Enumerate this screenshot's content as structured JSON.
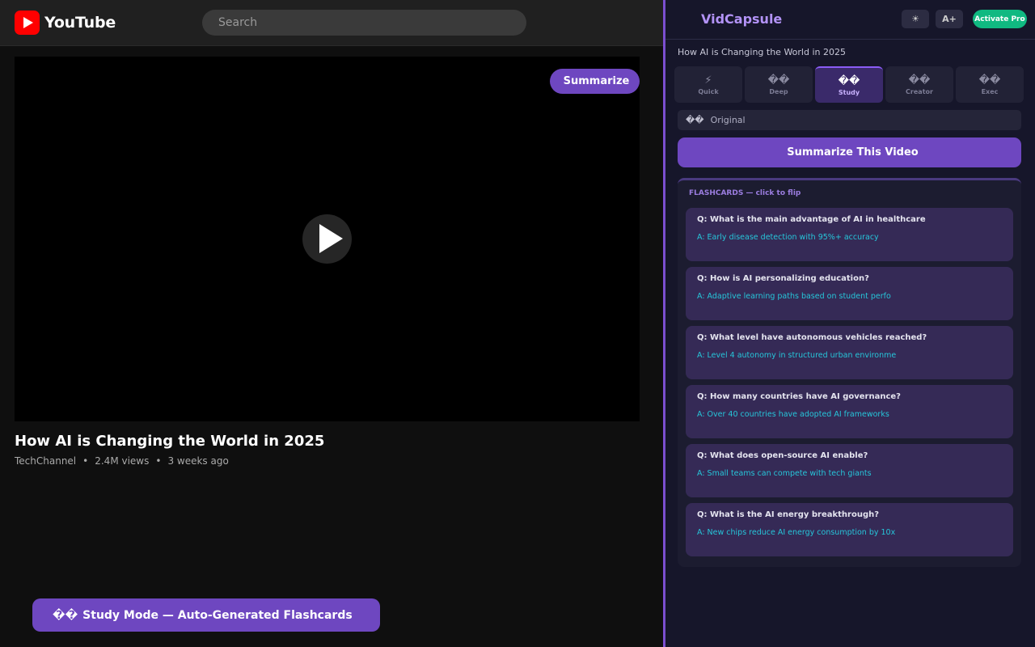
{
  "youtube": {
    "logo_text": "YouTube",
    "search_placeholder": "Search",
    "overlay_button": {
      "icon": "",
      "label": "Summarize"
    },
    "video": {
      "title": "How AI is Changing the World in 2025",
      "channel": "TechChannel",
      "separator": "•",
      "views": "2.4M views",
      "age": "3 weeks ago"
    },
    "study_banner": {
      "icon": "��",
      "label": "Study Mode — Auto-Generated Flashcards"
    }
  },
  "vidcapsule": {
    "logo_icon": "",
    "title": "VidCapsule",
    "theme_button": "☀",
    "font_button": "A+",
    "pro_button": "Activate Pro",
    "video_title": "How AI is Changing the World in 2025",
    "modes": [
      {
        "icon": "⚡",
        "label": "Quick",
        "active": false
      },
      {
        "icon": "��",
        "label": "Deep",
        "active": false
      },
      {
        "icon": "��",
        "label": "Study",
        "active": true
      },
      {
        "icon": "��",
        "label": "Creator",
        "active": false
      },
      {
        "icon": "��",
        "label": "Exec",
        "active": false
      }
    ],
    "language": {
      "icon": "��",
      "value": "Original"
    },
    "summarize_button": {
      "icon": "",
      "label": "Summarize This Video"
    },
    "flashcards": {
      "heading": "FLASHCARDS — click to flip",
      "cards": [
        {
          "q": "Q: What is the main advantage of AI in healthcare",
          "a": "A: Early disease detection with 95%+ accuracy"
        },
        {
          "q": "Q: How is AI personalizing education?",
          "a": "A: Adaptive learning paths based on student perfo"
        },
        {
          "q": "Q: What level have autonomous vehicles reached?",
          "a": "A: Level 4 autonomy in structured urban environme"
        },
        {
          "q": "Q: How many countries have AI governance?",
          "a": "A: Over 40 countries have adopted AI frameworks"
        },
        {
          "q": "Q: What does open-source AI enable?",
          "a": "A: Small teams can compete with tech giants"
        },
        {
          "q": "Q: What is the AI energy breakthrough?",
          "a": "A: New chips reduce AI energy consumption by 10x"
        }
      ]
    }
  },
  "colors": {
    "accent": "#6e47c0",
    "answer_text": "#26c6da",
    "pro_green": "#10b981",
    "youtube_red": "#ff0000"
  }
}
